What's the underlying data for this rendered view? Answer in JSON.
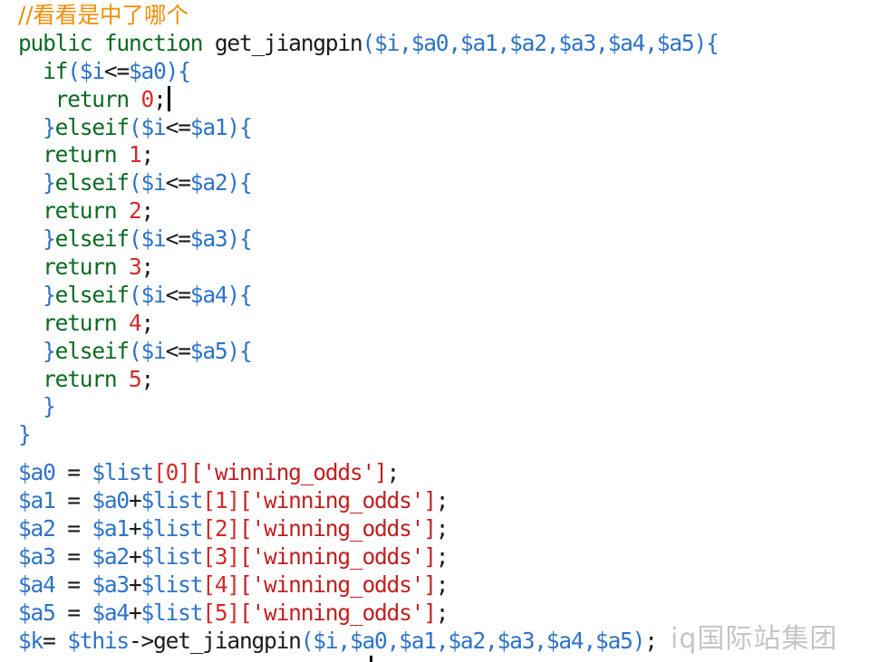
{
  "editor": {
    "lines": [
      {
        "kind": "comment",
        "text": "//看看是中了哪个"
      },
      {
        "kind": "fn-sig",
        "public": "public",
        "function": "function",
        "name": "get_jiangpin",
        "params": "($i,$a0,$a1,$a2,$a3,$a4,$a5){"
      },
      {
        "kind": "if",
        "indent": "  ",
        "kw": "if",
        "cond": "($i<=$a0){"
      },
      {
        "kind": "return",
        "indent": "   ",
        "kw": "return",
        "val": "0",
        "semi": ";",
        "cursor": true
      },
      {
        "kind": "elseif",
        "indent": "  ",
        "brace": "}",
        "kw": "elseif",
        "cond": "($i<=$a1){"
      },
      {
        "kind": "return",
        "indent": "  ",
        "kw": "return",
        "val": "1",
        "semi": ";"
      },
      {
        "kind": "elseif",
        "indent": "  ",
        "brace": "}",
        "kw": "elseif",
        "cond": "($i<=$a2){"
      },
      {
        "kind": "return",
        "indent": "  ",
        "kw": "return",
        "val": "2",
        "semi": ";"
      },
      {
        "kind": "elseif",
        "indent": "  ",
        "brace": "}",
        "kw": "elseif",
        "cond": "($i<=$a3){"
      },
      {
        "kind": "return",
        "indent": "  ",
        "kw": "return",
        "val": "3",
        "semi": ";"
      },
      {
        "kind": "elseif",
        "indent": "  ",
        "brace": "}",
        "kw": "elseif",
        "cond": "($i<=$a4){"
      },
      {
        "kind": "return",
        "indent": "  ",
        "kw": "return",
        "val": "4",
        "semi": ";"
      },
      {
        "kind": "elseif",
        "indent": "  ",
        "brace": "}",
        "kw": "elseif",
        "cond": "($i<=$a5){"
      },
      {
        "kind": "return",
        "indent": "  ",
        "kw": "return",
        "val": "5",
        "semi": ";"
      },
      {
        "kind": "close",
        "indent": "  ",
        "brace": "}"
      },
      {
        "kind": "close",
        "indent": "",
        "brace": "}"
      },
      {
        "kind": "gap"
      },
      {
        "kind": "assign",
        "lhs": "$a0",
        "eq": " = ",
        "prev": "",
        "list": "$list",
        "idx": "[0]",
        "key": "['winning_odds']",
        "semi": ";"
      },
      {
        "kind": "assign",
        "lhs": "$a1",
        "eq": " = ",
        "prev": "$a0+",
        "list": "$list",
        "idx": "[1]",
        "key": "['winning_odds']",
        "semi": ";"
      },
      {
        "kind": "assign",
        "lhs": "$a2",
        "eq": " = ",
        "prev": "$a1+",
        "list": "$list",
        "idx": "[2]",
        "key": "['winning_odds']",
        "semi": ";"
      },
      {
        "kind": "assign",
        "lhs": "$a3",
        "eq": " = ",
        "prev": "$a2+",
        "list": "$list",
        "idx": "[3]",
        "key": "['winning_odds']",
        "semi": ";"
      },
      {
        "kind": "assign",
        "lhs": "$a4",
        "eq": " = ",
        "prev": "$a3+",
        "list": "$list",
        "idx": "[4]",
        "key": "['winning_odds']",
        "semi": ";"
      },
      {
        "kind": "assign",
        "lhs": "$a5",
        "eq": " = ",
        "prev": "$a4+",
        "list": "$list",
        "idx": "[5]",
        "key": "['winning_odds']",
        "semi": ";"
      },
      {
        "kind": "call",
        "lhs": "$k",
        "eq": "= ",
        "obj": "$this",
        "arrow": "->",
        "name": "get_jiangpin",
        "args": "($i,$a0,$a1,$a2,$a3,$a4,$a5)",
        "semi": ";"
      }
    ]
  },
  "watermark": {
    "text": "iq国际站集团"
  },
  "colors": {
    "keyword": "#0b6a22",
    "variable": "#2d73c8",
    "number": "#d32a2a",
    "string": "#c21f1f",
    "comment": "#f08c00"
  }
}
